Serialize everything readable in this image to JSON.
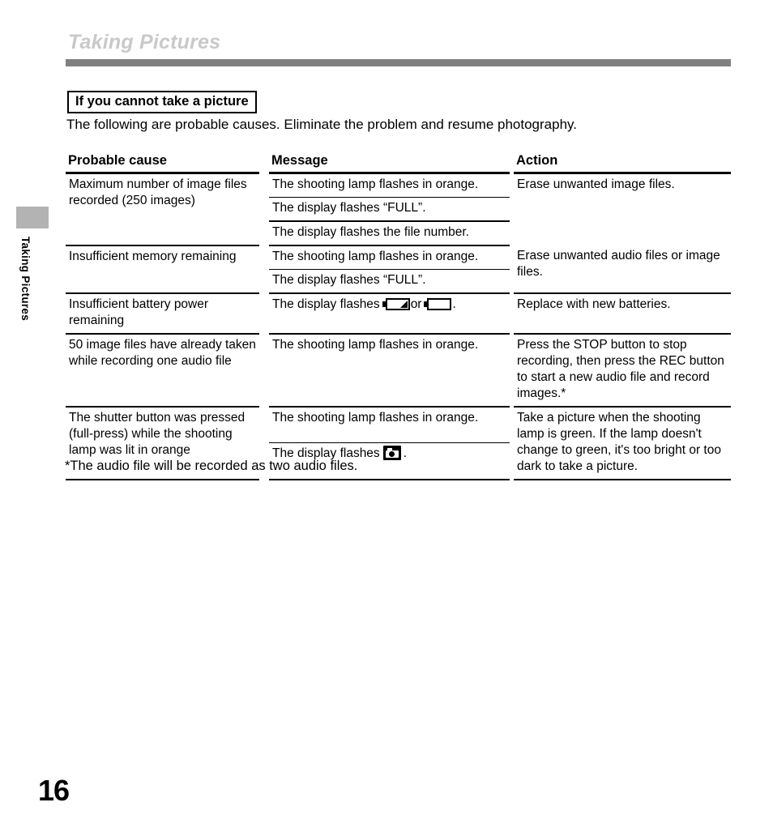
{
  "page": {
    "running_head": "Taking Pictures",
    "side_tab_label": "Taking Pictures",
    "page_number": "16",
    "rule_color": "#808080",
    "running_head_color": "#c9c9c9",
    "side_tab_color": "#b3b3b3"
  },
  "section": {
    "heading": "If you cannot take a picture",
    "intro": "The following are probable causes. Eliminate the problem and resume photography."
  },
  "table": {
    "headers": [
      "Probable cause",
      "Message",
      "Action"
    ],
    "rows": [
      {
        "cause": "Maximum number of image files recorded (250 images)",
        "messages": [
          "The shooting lamp flashes in orange.",
          "The display flashes “FULL”.",
          "The display flashes the file number."
        ],
        "action": "Erase unwanted image files."
      },
      {
        "cause": "Insufficient memory remaining",
        "messages": [
          "The shooting lamp flashes in orange.",
          "The display flashes “FULL”."
        ],
        "action": "Erase unwanted audio files or image files."
      },
      {
        "cause": "Insufficient battery power remaining",
        "messages": [
          "The display flashes [battery-low-icon] or [battery-empty-icon] ."
        ],
        "message_prefix": "The display flashes",
        "message_middle": "or",
        "message_suffix": ".",
        "action": "Replace with new batteries."
      },
      {
        "cause": "50 image files have already taken while recording one audio file",
        "messages": [
          "The shooting lamp flashes in orange."
        ],
        "action": "Press the STOP button to stop recording, then press the REC button to start a new audio file and record images.*"
      },
      {
        "cause": "The shutter button was pressed (full-press) while the shooting lamp was lit in orange",
        "messages": [
          "The shooting lamp flashes in orange.",
          "The display flashes [camera-icon] ."
        ],
        "message_line2_prefix": "The display flashes",
        "message_line2_suffix": ".",
        "action": "Take a picture when the shooting lamp is green. If the lamp doesn't change to green, it's too bright or too dark to take a picture."
      }
    ]
  },
  "footnote": "*The audio file will be recorded as two audio files."
}
